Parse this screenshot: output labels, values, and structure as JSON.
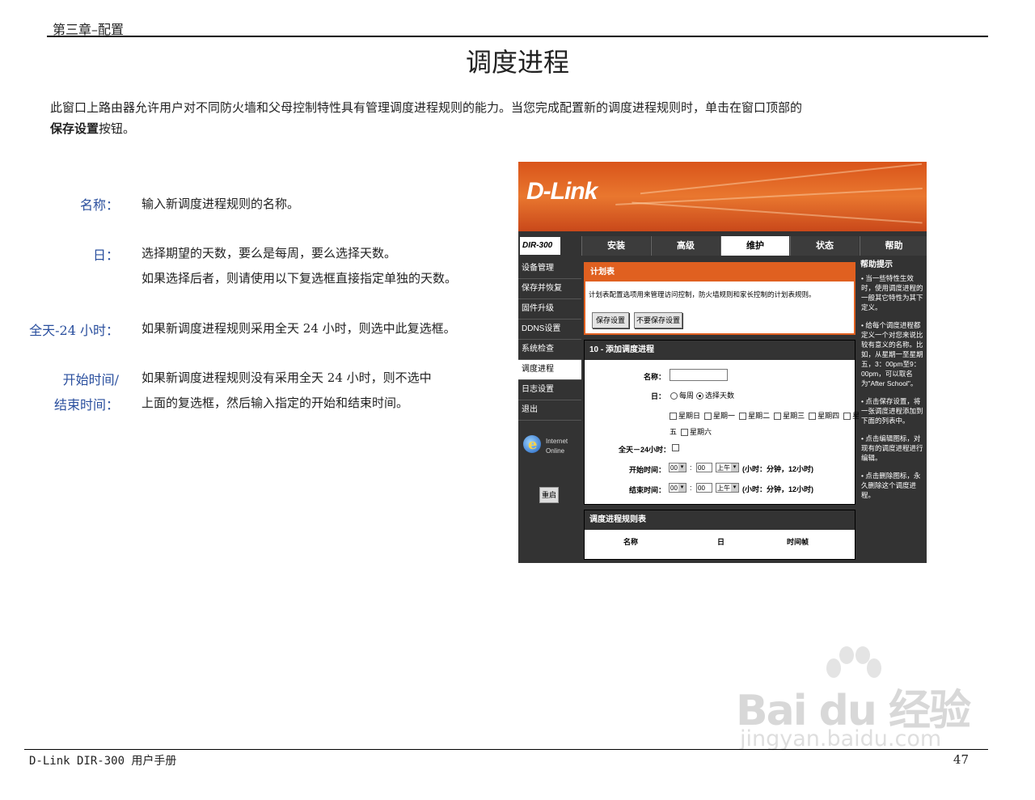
{
  "header": {
    "chapter": "第三章–配置",
    "title": "调度进程"
  },
  "intro": {
    "text": "此窗口上路由器允许用户对不同防火墙和父母控制特性具有管理调度进程规则的能力。当您完成配置新的调度进程规则时，单击在窗口顶部的",
    "bold": "保存设置",
    "tail": "按钮。"
  },
  "fields": [
    {
      "term": "名称：",
      "desc": [
        "输入新调度进程规则的名称。"
      ]
    },
    {
      "term": "日：",
      "desc": [
        "选择期望的天数，要么是每周，要么选择天数。",
        "如果选择后者，则请使用以下复选框直接指定单独的天数。"
      ]
    },
    {
      "term": "全天-24 小时：",
      "desc": [
        "如果新调度进程规则采用全天 24 小时，则选中此复选框。"
      ]
    },
    {
      "term": [
        "开始时间/",
        "结束时间："
      ],
      "desc": [
        "如果新调度进程规则没有采用全天 24 小时，则不选中",
        "上面的复选框，然后输入指定的开始和结束时间。"
      ]
    }
  ],
  "router": {
    "logo": "D-Link",
    "model": "DIR-300",
    "tabs": [
      "安装",
      "高级",
      "维护",
      "状态",
      "帮助"
    ],
    "active_tab": 2,
    "sidebar": [
      "设备管理",
      "保存并恢复",
      "固件升级",
      "DDNS设置",
      "系统检查",
      "调度进程",
      "日志设置",
      "退出"
    ],
    "active_side": 5,
    "ie_label": [
      "Internet",
      "Online"
    ],
    "reboot": "重启",
    "schedule_box": {
      "title": "计划表",
      "text": "计划表配置选项用来管理访问控制，防火墙规则和家长控制的计划表规则。",
      "save": "保存设置",
      "dont_save": "不要保存设置"
    },
    "add_box": {
      "title": "10 - 添加调度进程",
      "name_label": "名称：",
      "day_label": "日：",
      "day_opt_week": "每周",
      "day_opt_select": "选择天数",
      "days_row1": [
        "星期日",
        "星期一",
        "星期二",
        "星期三",
        "星期四",
        "星期"
      ],
      "days_row2_prefix": "五",
      "days_row2": [
        "星期六"
      ],
      "allday_label": "全天－24小时：",
      "start_label": "开始时间：",
      "end_label": "结束时间：",
      "hour": "00",
      "minute": "00",
      "ampm": "上午",
      "time_hint": "(小时：分钟，12小时)"
    },
    "list_box": {
      "title": "调度进程规则表",
      "cols": [
        "名称",
        "日",
        "时间帧"
      ]
    },
    "help": {
      "title": "帮助提示",
      "items": [
        "• 当一些特性生效时，使用调度进程的一般其它特性为其下定义。",
        "• 给每个调度进程都定义一个对您来说比较有意义的名称。比如，从星期一至星期五，3：00pm至9：00pm，可以取名为\"After School\"。",
        "• 点击保存设置，将一张调度进程添加到下面的列表中。",
        "• 点击编辑图标，对现有的调度进程进行编辑。",
        "• 点击删除图标，永久删除这个调度进程。"
      ]
    }
  },
  "footer": {
    "left": "D-Link DIR-300 用户手册",
    "page": "47"
  },
  "watermark": {
    "big": "Bai du 经验",
    "small": "jingyan.baidu.com"
  }
}
